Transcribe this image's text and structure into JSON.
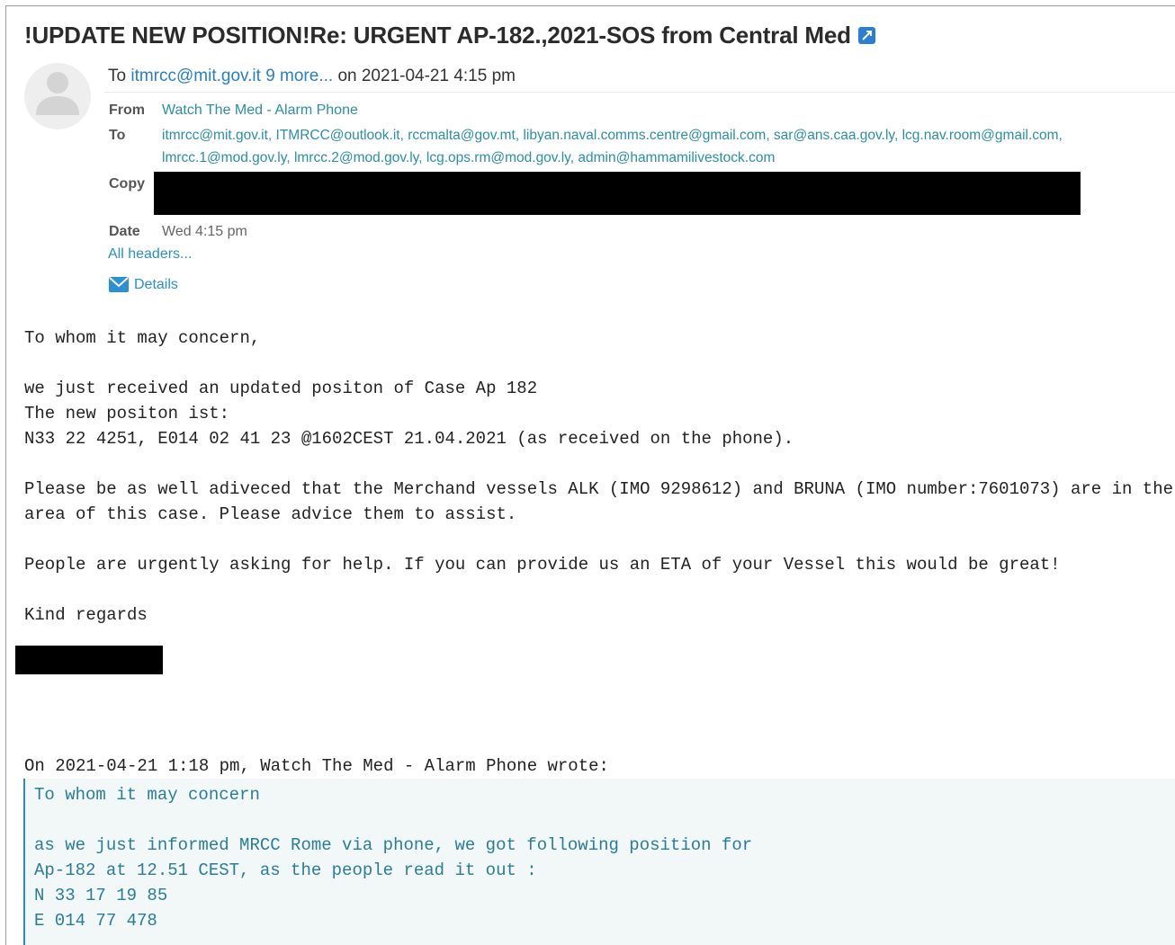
{
  "subject": "!UPDATE NEW POSITION!Re: URGENT AP-182.,2021-SOS from Central Med",
  "summary": {
    "to_prefix": "To",
    "to_link": "itmrcc@mit.gov.it 9 more...",
    "date_text": "on 2021-04-21 4:15 pm"
  },
  "headers": {
    "from_label": "From",
    "from_value": "Watch The Med - Alarm Phone",
    "to_label": "To",
    "to_line1": "itmrcc@mit.gov.it, ITMRCC@outlook.it, rccmalta@gov.mt, libyan.naval.comms.centre@gmail.com, sar@ans.caa.gov.ly, lcg.nav.room@gmail.com,",
    "to_line2": "lmrcc.1@mod.gov.ly, lmrcc.2@mod.gov.ly, lcg.ops.rm@mod.gov.ly, admin@hammamilivestock.com",
    "copy_label": "Copy",
    "date_label": "Date",
    "date_value": "Wed 4:15 pm",
    "all_headers": "All headers...",
    "details": "Details"
  },
  "body": "To whom it may concern,\n\nwe just received an updated positon of Case Ap 182\nThe new positon ist:\nN33 22 4251, E014 02 41 23 @1602CEST 21.04.2021 (as received on the phone).\n\nPlease be as well adiveced that the Merchand vessels ALK (IMO 9298612) and BRUNA (IMO number:7601073) are in the\narea of this case. Please advice them to assist.\n\nPeople are urgently asking for help. If you can provide us an ETA of your Vessel this would be great!\n\nKind regards",
  "quote_intro": "On 2021-04-21 1:18 pm, Watch The Med - Alarm Phone wrote:",
  "quote": "To whom it may concern\n\nas we just informed MRCC Rome via phone, we got following position for\nAp-182 at 12.51 CEST, as the people read it out :\nN 33 17 19 85\nE 014 77 478",
  "colors": {
    "link": "#2a7fc0",
    "header_value": "#2a8fa8",
    "quote_text": "#2a7d98",
    "redaction": "#000000"
  }
}
